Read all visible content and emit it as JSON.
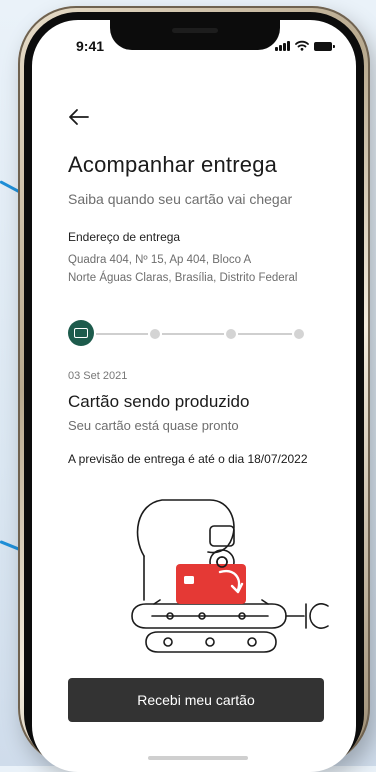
{
  "status_bar": {
    "time": "9:41"
  },
  "header": {
    "title": "Acompanhar entrega",
    "subtitle": "Saiba quando seu cartão vai chegar"
  },
  "address": {
    "label": "Endereço de entrega",
    "line1": "Quadra 404, Nº 15, Ap 404, Bloco A",
    "line2": "Norte Águas Claras, Brasília, Distrito Federal"
  },
  "tracking": {
    "steps_total": 4,
    "current_step": 1,
    "date": "03 Set 2021",
    "status_title": "Cartão sendo produzido",
    "status_subtitle": "Seu cartão está quase pronto",
    "forecast": "A previsão de entrega é até o dia 18/07/2022"
  },
  "illustration": {
    "icon": "card-factory-illustration",
    "accent_color": "#e53935"
  },
  "cta": {
    "label": "Recebi meu cartão"
  },
  "colors": {
    "primary_dark": "#1d5b4c",
    "button": "#333333",
    "accent_blue": "#1f8fd8"
  }
}
